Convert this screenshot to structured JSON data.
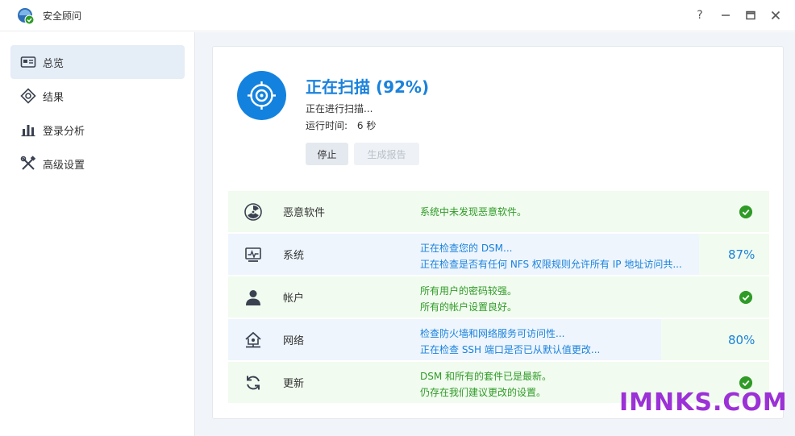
{
  "window": {
    "title": "安全顾问"
  },
  "sidebar": {
    "items": [
      {
        "label": "总览"
      },
      {
        "label": "结果"
      },
      {
        "label": "登录分析"
      },
      {
        "label": "高级设置"
      }
    ]
  },
  "scan": {
    "title": "正在扫描 (92%)",
    "progress_percent": 92,
    "subtitle": "正在进行扫描...",
    "runtime_label": "运行时间:",
    "runtime_value": "6 秒",
    "stop_label": "停止",
    "report_label": "生成报告"
  },
  "rows": [
    {
      "name": "恶意软件",
      "line1": "系统中未发现恶意软件。",
      "line2": "",
      "status": "ok"
    },
    {
      "name": "系统",
      "line1": "正在检查您的 DSM...",
      "line2": "正在检查是否有任何 NFS 权限规则允许所有 IP 地址访问共...",
      "status": "running",
      "percent_text": "87%",
      "progress": 0.87
    },
    {
      "name": "帐户",
      "line1": "所有用户的密码较强。",
      "line2": "所有的帐户设置良好。",
      "status": "ok"
    },
    {
      "name": "网络",
      "line1": "检查防火墙和网络服务可访问性...",
      "line2": "正在检查 SSH 端口是否已从默认值更改...",
      "status": "running",
      "percent_text": "80%",
      "progress": 0.8
    },
    {
      "name": "更新",
      "line1": "DSM 和所有的套件已是最新。",
      "line2": "仍存在我们建议更改的设置。",
      "status": "ok"
    }
  ],
  "watermark": "IMNKS.COM",
  "colors": {
    "accent": "#1a82dc",
    "ok": "#2f9b27",
    "watermark": "#9b31d6"
  }
}
